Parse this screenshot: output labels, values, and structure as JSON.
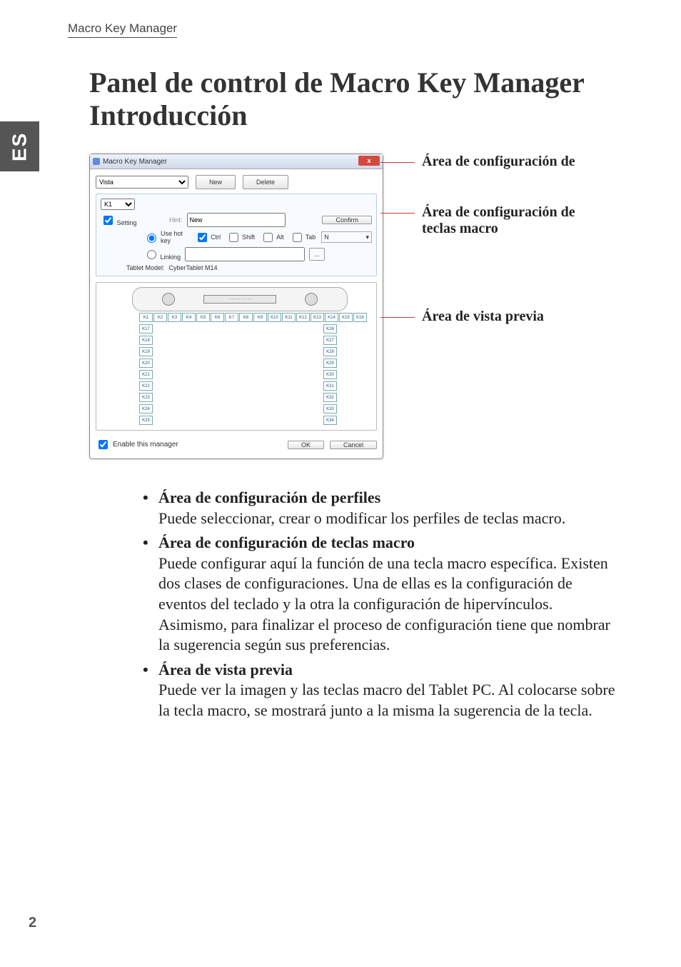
{
  "sideTab": "ES",
  "runningHead": "Macro Key Manager",
  "title": "Panel de control de Macro Key Manager Introducción",
  "pageNumber": "2",
  "window": {
    "title": "Macro Key Manager",
    "close": "x",
    "profile": {
      "selected": "Vista",
      "newBtn": "New",
      "deleteBtn": "Delete"
    },
    "macro": {
      "keySelected": "K1",
      "settingCheckbox": "Setting",
      "hintLabel": "Hint:",
      "hintValue": "New",
      "confirmBtn": "Confirm",
      "useHotKey": "Use hot key",
      "ctrl": "Ctrl",
      "shift": "Shift",
      "alt": "Alt",
      "tab": "Tab",
      "comboValue": "N",
      "linking": "Linking",
      "dots": "...",
      "tabletModelLabel": "Tablet Model:",
      "tabletModelValue": "CyberTablet M14"
    },
    "preview": {
      "topKeys": [
        "K1",
        "K2",
        "K3",
        "K4",
        "K5",
        "K6",
        "K7",
        "K8",
        "K9",
        "K10",
        "K11",
        "K12",
        "K13",
        "K14",
        "K15",
        "K16"
      ],
      "leftKeys": [
        "K17",
        "K18",
        "K19",
        "K20",
        "K21",
        "K22",
        "K23",
        "K24",
        "K25"
      ],
      "rightKeys": [
        "K26",
        "K27",
        "K28",
        "K29",
        "K30",
        "K31",
        "K32",
        "K33",
        "K34"
      ]
    },
    "enableLabel": "Enable this manager",
    "okBtn": "OK",
    "cancelBtn": "Cancel"
  },
  "callouts": {
    "c1": "Área de configuración de",
    "c2a": "Área de configuración de",
    "c2b": "teclas macro",
    "c3": "Área de vista previa"
  },
  "bullets": {
    "b1Title": "Área de configuración de perfiles",
    "b1Body": "Puede seleccionar, crear o modificar los perfiles de teclas macro.",
    "b2Title": "Área de configuración de teclas macro",
    "b2Body": "Puede configurar aquí la función de una tecla macro específica. Existen dos clases de configuraciones. Una de ellas es la configuración de eventos del teclado y la otra la configuración de hipervínculos. Asimismo, para finalizar el proceso de configuración tiene que nombrar la sugerencia según sus preferencias.",
    "b3Title": "Área de vista previa",
    "b3Body": "Puede ver la imagen y las teclas macro del Tablet PC. Al colocarse sobre la tecla macro, se mostrará junto a la misma la sugerencia de la tecla."
  }
}
